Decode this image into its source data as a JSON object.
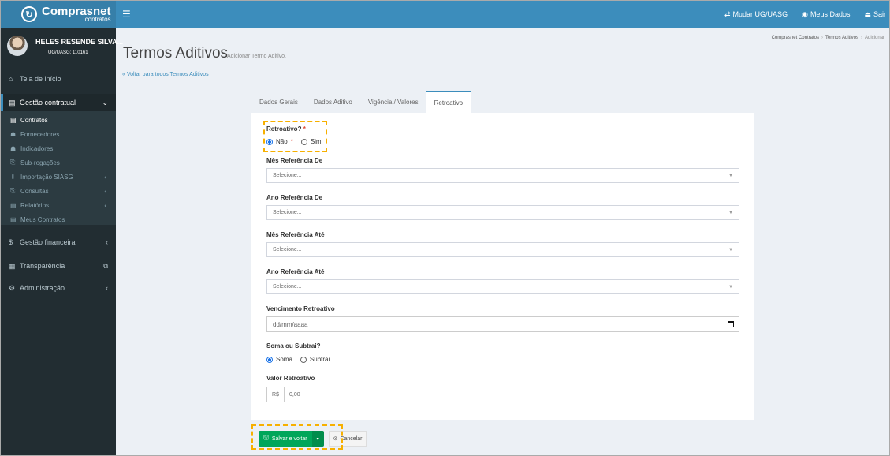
{
  "header": {
    "logo_main": "Comprasnet",
    "logo_sub": "contratos",
    "menu_icon": "☰",
    "nav": [
      {
        "icon": "⇄",
        "label": "Mudar UG/UASG"
      },
      {
        "icon": "◉",
        "label": "Meus Dados"
      },
      {
        "icon": "⏏",
        "label": "Sair"
      }
    ]
  },
  "sidebar": {
    "user_name": "HELES RESENDE SILVA...",
    "user_code": "UG/UASG: 110161",
    "items": [
      {
        "icon": "⌂",
        "label": "Tela de início"
      },
      {
        "icon": "▤",
        "label": "Gestão contratual",
        "arrow": "⌄"
      },
      {
        "icon": "$",
        "label": "Gestão financeira",
        "arrow": "‹"
      },
      {
        "icon": "▦",
        "label": "Transparência",
        "arrow": "⧉"
      },
      {
        "icon": "⚙",
        "label": "Administração",
        "arrow": "‹"
      }
    ],
    "submenu": [
      {
        "icon": "▤",
        "label": "Contratos"
      },
      {
        "icon": "☗",
        "label": "Fornecedores"
      },
      {
        "icon": "☗",
        "label": "Indicadores"
      },
      {
        "icon": "⎘",
        "label": "Sub-rogações"
      },
      {
        "icon": "⬇",
        "label": "Importação SIASG",
        "arrow": "‹"
      },
      {
        "icon": "⎘",
        "label": "Consultas",
        "arrow": "‹"
      },
      {
        "icon": "▤",
        "label": "Relatórios",
        "arrow": "‹"
      },
      {
        "icon": "▤",
        "label": "Meus Contratos"
      }
    ]
  },
  "page": {
    "title": "Termos Aditivos",
    "subtitle": "Adicionar Termo Aditivo.",
    "back_link": "« Voltar para todos Termos Aditivos",
    "breadcrumb": [
      "Comprasnet Contratos",
      "Termos Aditivos",
      "Adicionar"
    ],
    "breadcrumb_sep": "›"
  },
  "tabs": [
    "Dados Gerais",
    "Dados Aditivo",
    "Vigência / Valores",
    "Retroativo"
  ],
  "form": {
    "retroativo_label": "Retroativo?",
    "required_mark": "*",
    "retroativo_options": [
      "Não",
      "Sim"
    ],
    "retroativo_selected": "Não",
    "mes_de_label": "Mês Referência De",
    "ano_de_label": "Ano Referência De",
    "mes_ate_label": "Mês Referência Até",
    "ano_ate_label": "Ano Referência Até",
    "select_placeholder": "Selecione...",
    "vencimento_label": "Vencimento Retroativo",
    "vencimento_placeholder": "dd/mm/aaaa",
    "soma_label": "Soma ou Subtrai?",
    "soma_options": [
      "Soma",
      "Subtrai"
    ],
    "soma_selected": "Soma",
    "valor_label": "Valor Retroativo",
    "valor_prefix": "R$",
    "valor_value": "0,00"
  },
  "actions": {
    "save_icon": "🖫",
    "save_label": "Salvar e voltar",
    "dropdown_caret": "▾",
    "cancel_icon": "⊘",
    "cancel_label": "Cancelar"
  },
  "colors": {
    "header": "#3c8dbc",
    "sidebar": "#222d32",
    "save": "#00a65a",
    "highlight": "#f7b000"
  }
}
